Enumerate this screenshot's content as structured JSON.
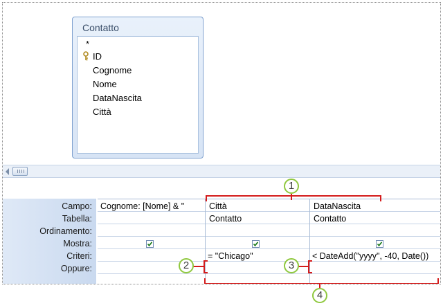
{
  "table": {
    "title": "Contatto",
    "fields": [
      "*",
      "ID",
      "Cognome",
      "Nome",
      "DataNascita",
      "Città"
    ]
  },
  "grid": {
    "row_labels": [
      "Campo:",
      "Tabella:",
      "Ordinamento:",
      "Mostra:",
      "Criteri:",
      "Oppure:"
    ],
    "columns": [
      {
        "campo": "Cognome: [Nome] & \"",
        "tabella": "",
        "mostra": true,
        "criteri": ""
      },
      {
        "campo": "Città",
        "tabella": "Contatto",
        "mostra": true,
        "criteri": "= \"Chicago\""
      },
      {
        "campo": "DataNascita",
        "tabella": "Contatto",
        "mostra": true,
        "criteri": "< DateAdd(\"yyyy\", -40, Date())"
      }
    ]
  },
  "callouts": [
    "1",
    "2",
    "3",
    "4"
  ],
  "colors": {
    "bracket": "#d41c1c",
    "callout_border": "#8fc83e"
  },
  "icons": {
    "primary_key": "key-icon",
    "checkbox": "checkmark-icon"
  }
}
